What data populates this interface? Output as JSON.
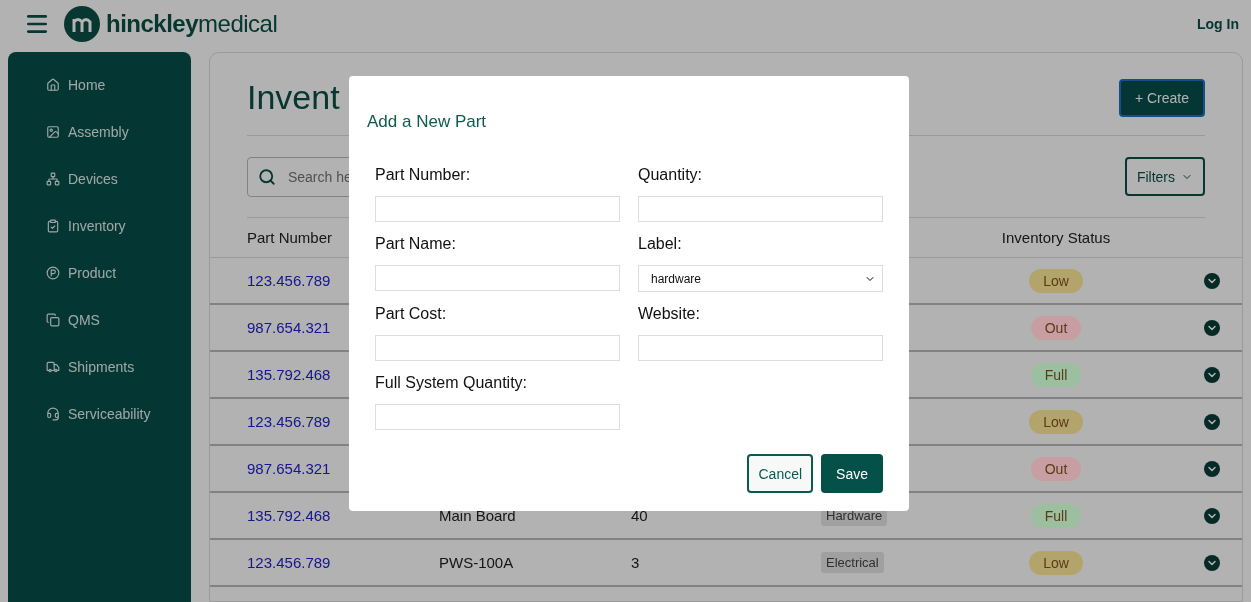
{
  "header": {
    "brand_bold": "hinckley",
    "brand_light": "medical",
    "login": "Log In"
  },
  "sidebar": {
    "items": [
      {
        "label": "Home"
      },
      {
        "label": "Assembly"
      },
      {
        "label": "Devices"
      },
      {
        "label": "Inventory"
      },
      {
        "label": "Product"
      },
      {
        "label": "QMS"
      },
      {
        "label": "Shipments"
      },
      {
        "label": "Serviceability"
      }
    ]
  },
  "main": {
    "title": "Invent",
    "create_button": "+ Create",
    "search": {
      "placeholder": "Search he"
    },
    "filters_button": "Filters",
    "columns": {
      "part_number": "Part Number",
      "inventory_status": "Inventory Status"
    },
    "rows": [
      {
        "part_number": "123.456.789",
        "status": "Low",
        "color": "#b3a46c"
      },
      {
        "part_number": "987.654.321",
        "status": "Out",
        "color": "#c89ea2"
      },
      {
        "part_number": "135.792.468",
        "status": "Full",
        "color": "#9cc09f"
      },
      {
        "part_number": "123.456.789",
        "status": "Low",
        "color": "#b3a46c"
      },
      {
        "part_number": "987.654.321",
        "status": "Out",
        "color": "#c89ea2"
      },
      {
        "part_number": "135.792.468",
        "part_name": "Main Board",
        "quantity": "40",
        "label": "Hardware",
        "status": "Full",
        "color": "#9cc09f"
      },
      {
        "part_number": "123.456.789",
        "part_name": "PWS-100A",
        "quantity": "3",
        "label": "Electrical",
        "status": "Low",
        "color": "#b3a46c"
      }
    ]
  },
  "modal": {
    "title": "Add a New Part",
    "fields": [
      {
        "label": "Part Number:",
        "kind": "text"
      },
      {
        "label": "Quantity:",
        "kind": "text"
      },
      {
        "label": "Part Name:",
        "kind": "text"
      },
      {
        "label": "Label:",
        "kind": "select",
        "value": "hardware"
      },
      {
        "label": "Part Cost:",
        "kind": "text"
      },
      {
        "label": "Website:",
        "kind": "text"
      },
      {
        "label": "Full System Quantity:",
        "kind": "text"
      }
    ],
    "cancel_button": "Cancel",
    "save_button": "Save"
  }
}
